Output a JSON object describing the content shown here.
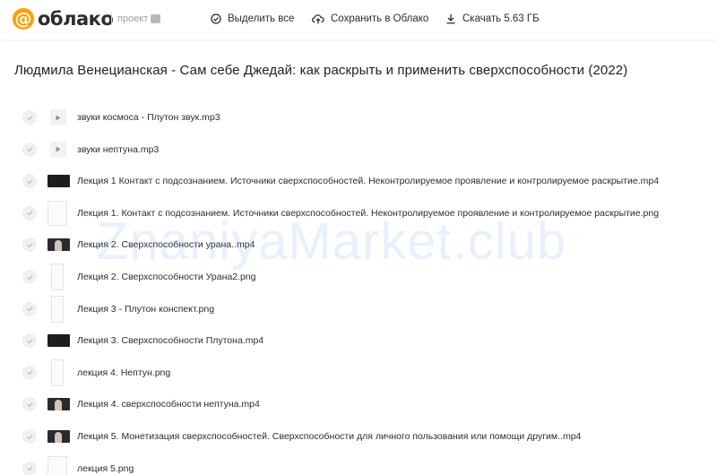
{
  "header": {
    "logo_at": "@",
    "logo_text": "облако",
    "logo_sub": "проект",
    "actions": {
      "select_all": "Выделить все",
      "save_to_cloud": "Сохранить в Облако",
      "download": "Скачать 5.63 ГБ"
    }
  },
  "folder": {
    "title": "Людмила Венецианская - Сам себе Джедай: как раскрыть и применить сверхспособности (2022)"
  },
  "files": [
    {
      "name": "звуки космоса - Плутон звук.mp3",
      "thumb": "audio"
    },
    {
      "name": "звуки нептуна.mp3",
      "thumb": "audio"
    },
    {
      "name": "Лекция 1 Контакт с подсознанием. Источники сверхспособностей. Неконтролируемое проявление и контролируемое раскрытие.mp4",
      "thumb": "video"
    },
    {
      "name": "Лекция 1. Контакт с подсознанием. Источники сверхспособностей. Неконтролируемое проявление и контролируемое раскрытие.png",
      "thumb": "doc"
    },
    {
      "name": "Лекция 2. Сверхспособности урана..mp4",
      "thumb": "video-face"
    },
    {
      "name": "Лекция 2. Сверхспособности Урана2.png",
      "thumb": "doc-narrow"
    },
    {
      "name": "Лекция 3 - Плутон конспект.png",
      "thumb": "doc-narrow"
    },
    {
      "name": "Лекция 3. Сверхспособности Плутона.mp4",
      "thumb": "video"
    },
    {
      "name": "лекция 4. Нептун.png",
      "thumb": "doc-narrow"
    },
    {
      "name": "Лекция 4. сверхспособности нептуна.mp4",
      "thumb": "video-face"
    },
    {
      "name": "Лекция 5. Монетизация сверхспособностей. Сверхспособности для личного пользования или помощи другим..mp4",
      "thumb": "video-face"
    },
    {
      "name": "лекция 5.png",
      "thumb": "doc"
    }
  ],
  "watermark": "ZnaniyaMarket.club",
  "colors": {
    "brand": "#ff9e00",
    "text": "#2c2d2e",
    "check_bg": "#eef0f3",
    "watermark": "#78a0f0"
  }
}
